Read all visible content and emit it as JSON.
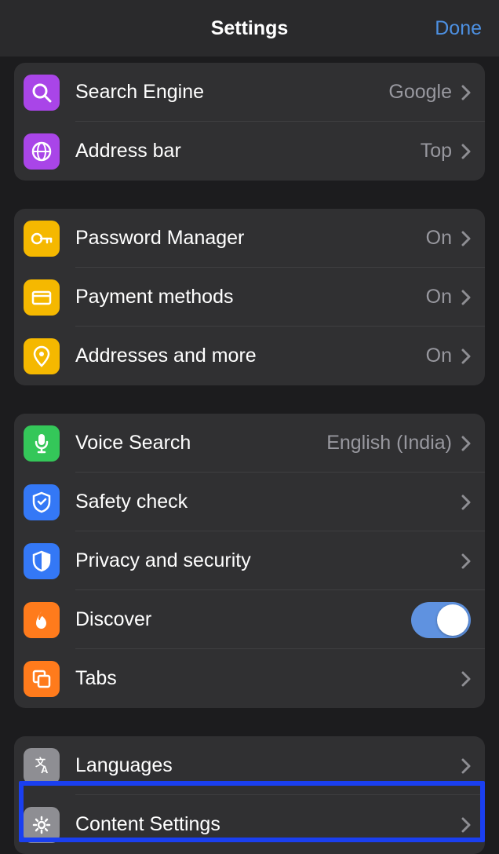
{
  "header": {
    "title": "Settings",
    "done": "Done"
  },
  "sections": [
    {
      "rows": [
        {
          "icon": "search",
          "iconColor": "purple",
          "label": "Search Engine",
          "value": "Google",
          "chevron": true
        },
        {
          "icon": "globe",
          "iconColor": "purple",
          "label": "Address bar",
          "value": "Top",
          "chevron": true
        }
      ]
    },
    {
      "rows": [
        {
          "icon": "key",
          "iconColor": "yellow",
          "label": "Password Manager",
          "value": "On",
          "chevron": true
        },
        {
          "icon": "card",
          "iconColor": "yellow",
          "label": "Payment methods",
          "value": "On",
          "chevron": true
        },
        {
          "icon": "pin",
          "iconColor": "yellow",
          "label": "Addresses and more",
          "value": "On",
          "chevron": true
        }
      ]
    },
    {
      "rows": [
        {
          "icon": "mic",
          "iconColor": "green",
          "label": "Voice Search",
          "value": "English (India)",
          "chevron": true
        },
        {
          "icon": "shield-check",
          "iconColor": "blue",
          "label": "Safety check",
          "value": "",
          "chevron": true
        },
        {
          "icon": "shield-half",
          "iconColor": "blue",
          "label": "Privacy and security",
          "value": "",
          "chevron": true
        },
        {
          "icon": "flame",
          "iconColor": "orange",
          "label": "Discover",
          "value": "",
          "toggle": true,
          "toggleOn": true
        },
        {
          "icon": "tabs",
          "iconColor": "orange",
          "label": "Tabs",
          "value": "",
          "chevron": true
        }
      ]
    },
    {
      "rows": [
        {
          "icon": "translate",
          "iconColor": "gray",
          "label": "Languages",
          "value": "",
          "chevron": true
        },
        {
          "icon": "gear",
          "iconColor": "gray",
          "label": "Content Settings",
          "value": "",
          "chevron": true
        }
      ]
    }
  ]
}
